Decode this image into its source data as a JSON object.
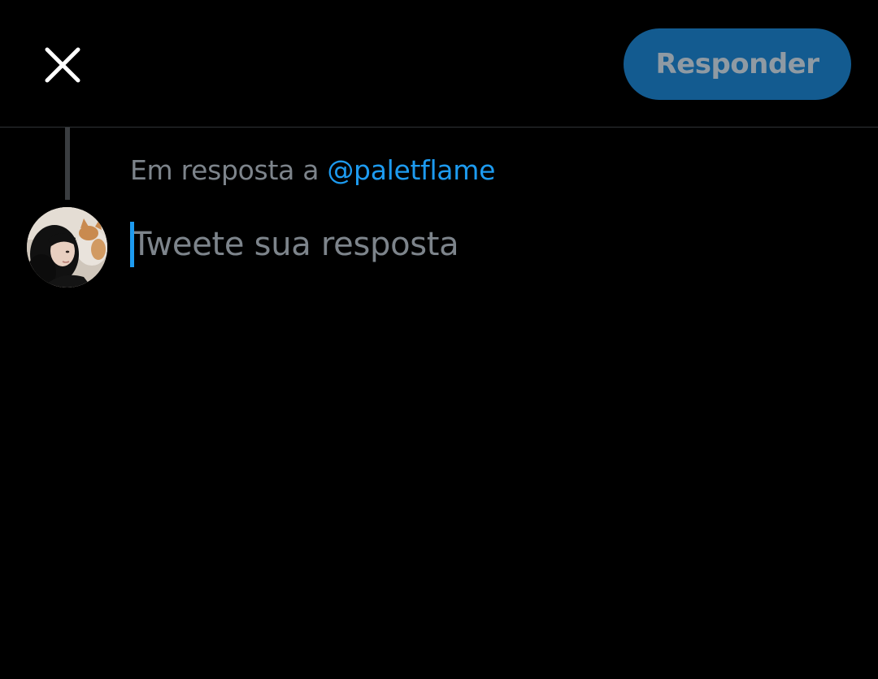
{
  "header": {
    "close_icon": "close-icon",
    "reply_button_label": "Responder"
  },
  "reply_context": {
    "prefix": "Em resposta a",
    "mention": "@paletflame"
  },
  "compose": {
    "placeholder": "Tweete sua resposta"
  },
  "avatar": {
    "icon": "user-avatar-photo"
  },
  "colors": {
    "background": "#000000",
    "accent": "#1d9bf0",
    "button_bg": "#135b90",
    "muted_text": "#7d848b"
  }
}
